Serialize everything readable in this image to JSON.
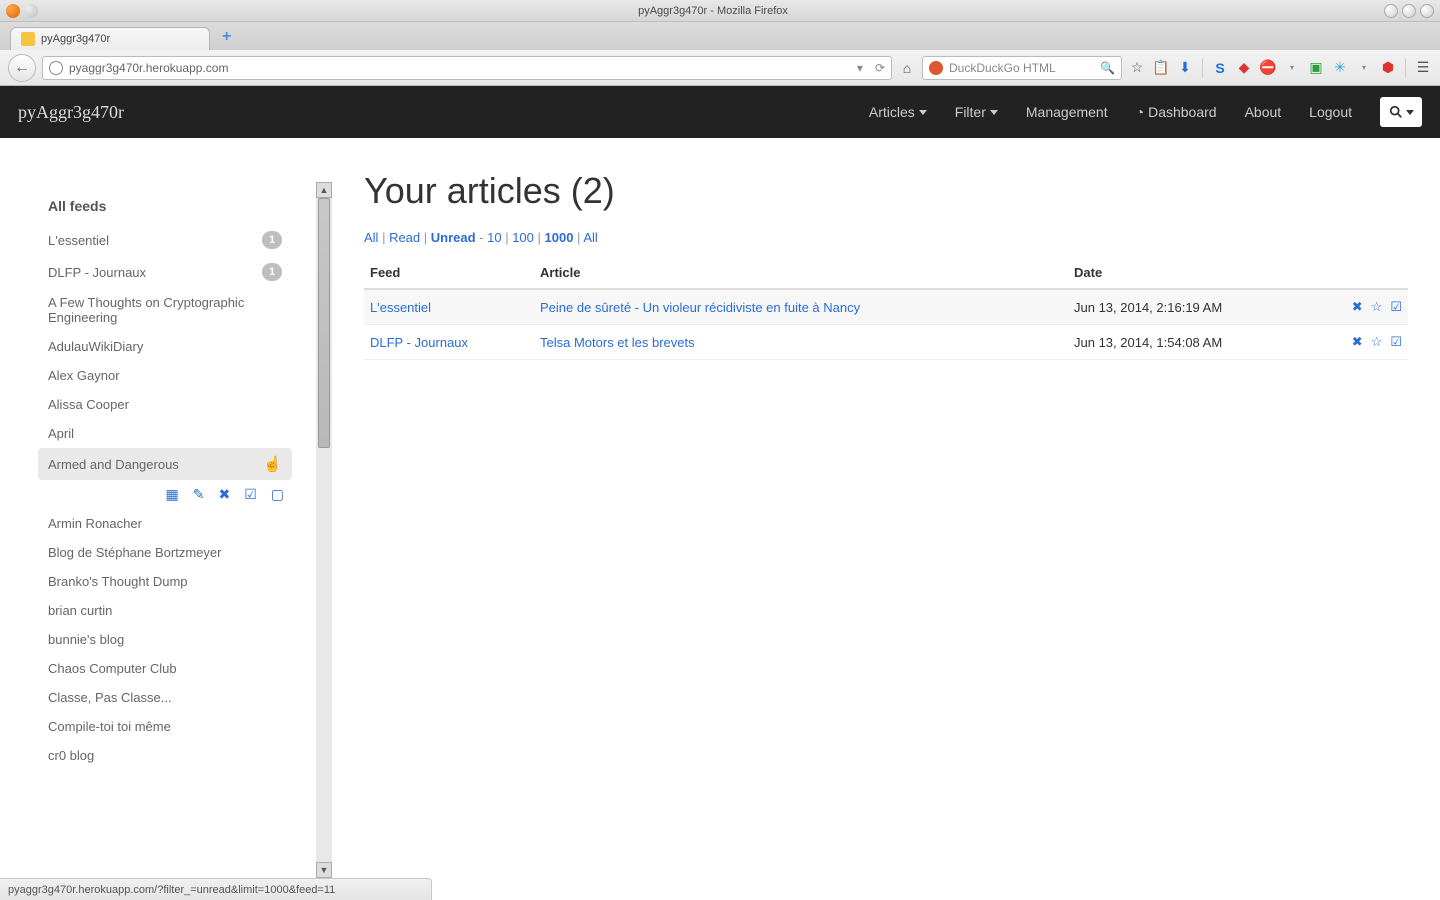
{
  "window": {
    "title": "pyAggr3g470r - Mozilla Firefox"
  },
  "browser": {
    "tab_title": "pyAggr3g470r",
    "url": "pyaggr3g470r.herokuapp.com",
    "search_placeholder": "DuckDuckGo HTML"
  },
  "navbar": {
    "brand": "pyAggr3g470r",
    "articles": "Articles",
    "filter": "Filter",
    "management": "Management",
    "dashboard": "Dashboard",
    "about": "About",
    "logout": "Logout"
  },
  "sidebar": {
    "heading": "All feeds",
    "items": [
      {
        "name": "L'essentiel",
        "badge": "1"
      },
      {
        "name": "DLFP - Journaux",
        "badge": "1"
      },
      {
        "name": "A Few Thoughts on Cryptographic Engineering"
      },
      {
        "name": "AdulauWikiDiary"
      },
      {
        "name": "Alex Gaynor"
      },
      {
        "name": "Alissa Cooper"
      },
      {
        "name": "April"
      },
      {
        "name": "Armed and Dangerous",
        "hover": true
      },
      {
        "name": "Armin Ronacher"
      },
      {
        "name": "Blog de Stéphane Bortzmeyer"
      },
      {
        "name": "Branko's Thought Dump"
      },
      {
        "name": "brian curtin"
      },
      {
        "name": "bunnie's blog"
      },
      {
        "name": "Chaos Computer Club"
      },
      {
        "name": "Classe, Pas Classe..."
      },
      {
        "name": "Compile-toi toi même"
      },
      {
        "name": "cr0 blog"
      }
    ]
  },
  "main": {
    "heading": "Your articles (2)",
    "filters": {
      "all": "All",
      "read": "Read",
      "unread": "Unread",
      "n10": "10",
      "n100": "100",
      "n1000": "1000",
      "all2": "All",
      "dash": " - ",
      "pipe": " | "
    },
    "columns": {
      "feed": "Feed",
      "article": "Article",
      "date": "Date"
    },
    "rows": [
      {
        "feed": "L'essentiel",
        "article": "Peine de sûreté - Un violeur récidiviste en fuite à Nancy",
        "date": "Jun 13, 2014, 2:16:19 AM"
      },
      {
        "feed": "DLFP - Journaux",
        "article": "Telsa Motors et les brevets",
        "date": "Jun 13, 2014, 1:54:08 AM"
      }
    ]
  },
  "statusbar": {
    "text": "pyaggr3g470r.herokuapp.com/?filter_=unread&limit=1000&feed=11"
  }
}
